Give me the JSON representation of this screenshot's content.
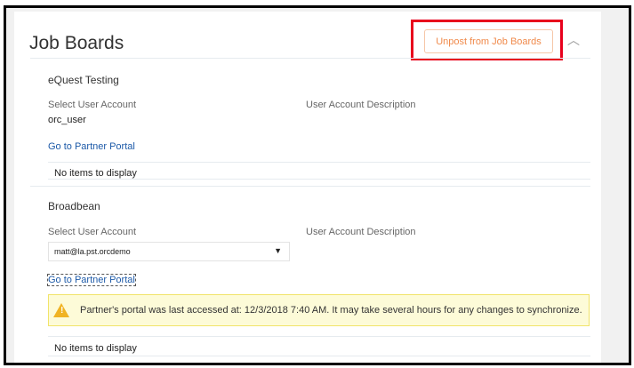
{
  "header": {
    "title": "Job Boards",
    "unpost_label": "Unpost from Job Boards"
  },
  "sections": [
    {
      "name": "eQuest Testing",
      "select_label": "Select User Account",
      "description_label": "User Account Description",
      "account": "orc_user",
      "portal_link": "Go to Partner Portal",
      "empty": "No items to display"
    },
    {
      "name": "Broadbean",
      "select_label": "Select User Account",
      "description_label": "User Account Description",
      "account": "matt@la.pst.orcdemo",
      "portal_link": "Go to Partner Portal",
      "warning": "Partner's portal was last accessed at: 12/3/2018 7:40 AM. It may take several hours for any changes to synchronize.",
      "empty": "No items to display"
    }
  ],
  "colors": {
    "accent": "#f08a4b",
    "highlight": "#e8001c",
    "link": "#1d5aa8",
    "warning_bg": "#fdfbd8"
  }
}
